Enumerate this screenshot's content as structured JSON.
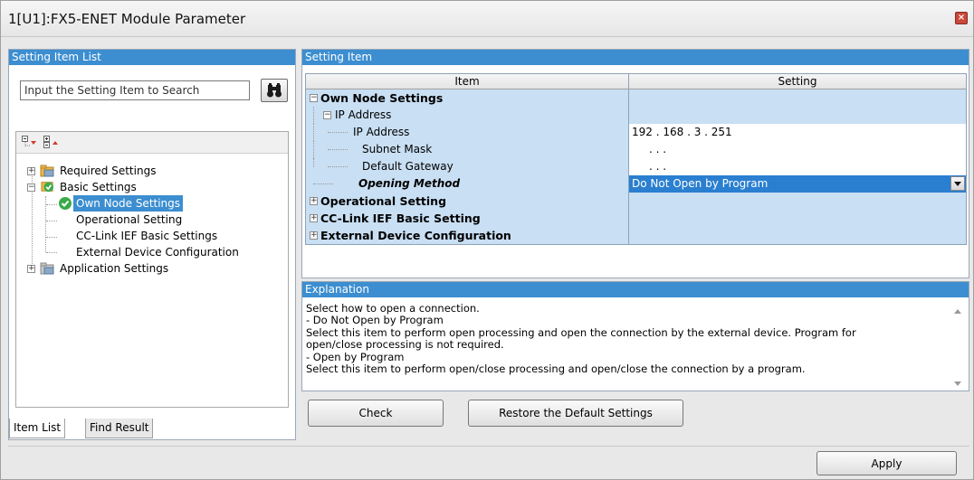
{
  "window": {
    "title": "1[U1]:FX5-ENET Module Parameter",
    "close_glyph": "×"
  },
  "left": {
    "header": "Setting Item List",
    "search_placeholder": "Input the Setting Item to Search",
    "tree": [
      {
        "label": "Required Settings",
        "icon": "folder-icon",
        "expander": "+"
      },
      {
        "label": "Basic Settings",
        "icon": "check-folder-icon",
        "expander": "−"
      },
      {
        "label": "Own Node Settings",
        "icon": "check-icon",
        "selected": true
      },
      {
        "label": "Operational Setting"
      },
      {
        "label": "CC-Link IEF Basic Settings"
      },
      {
        "label": "External Device Configuration"
      },
      {
        "label": "Application Settings",
        "icon": "folder-icon",
        "expander": "+"
      }
    ],
    "tabs": [
      "Item List",
      "Find Result"
    ]
  },
  "right": {
    "header": "Setting Item",
    "columns": [
      "Item",
      "Setting"
    ],
    "rows": [
      {
        "item": "Own Node Settings",
        "setting": ""
      },
      {
        "item": "IP Address",
        "setting": ""
      },
      {
        "item": "IP Address",
        "setting": "192 . 168 .   3 . 251"
      },
      {
        "item": "Subnet Mask",
        "setting": ".      .      ."
      },
      {
        "item": "Default Gateway",
        "setting": ".      .      ."
      },
      {
        "item": "Opening Method",
        "setting": "Do Not Open by Program"
      },
      {
        "item": "Operational Setting",
        "setting": ""
      },
      {
        "item": "CC-Link IEF Basic Setting",
        "setting": ""
      },
      {
        "item": "External Device Configuration",
        "setting": ""
      }
    ]
  },
  "explanation": {
    "header": "Explanation",
    "text": "Select how to open a connection.\n- Do Not Open by Program\nSelect this item to perform open processing and open the connection by the external device. Program for\nopen/close processing is not required.\n- Open by Program\nSelect this item to perform open/close processing and open/close the connection by a program."
  },
  "buttons": {
    "check": "Check",
    "restore": "Restore the Default Settings",
    "apply": "Apply"
  },
  "colors": {
    "header_blue": "#3c8ed0",
    "row_blue": "#c9dff3",
    "selection": "#2a7fd0"
  }
}
